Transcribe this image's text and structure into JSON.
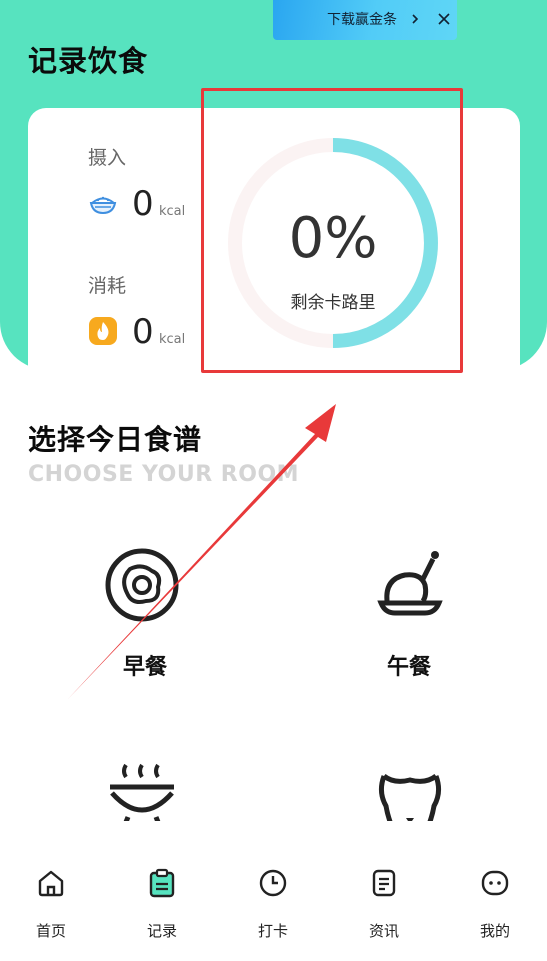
{
  "status_bar": {
    "left_fragment": "",
    "right_fragment": ""
  },
  "promo": {
    "text": "下载赢金条",
    "chevron_icon": "chevron-right-icon",
    "close_icon": "close-icon"
  },
  "header": {
    "title": "记录饮食"
  },
  "stats": {
    "intake": {
      "label": "摄入",
      "value": "0",
      "unit": "kcal",
      "icon": "rice-bowl-icon"
    },
    "burn": {
      "label": "消耗",
      "value": "0",
      "unit": "kcal",
      "icon": "flame-icon"
    },
    "ring": {
      "percent_text": "0%",
      "caption": "剩余卡路里",
      "progress": 0.5
    }
  },
  "recipe_section": {
    "title": "选择今日食谱",
    "subtitle": "CHOOSE YOUR ROOM",
    "meals": [
      {
        "label": "早餐",
        "icon": "fried-egg-plate-icon"
      },
      {
        "label": "午餐",
        "icon": "roast-chicken-icon"
      },
      {
        "label": "",
        "icon": "grill-icon"
      },
      {
        "label": "",
        "icon": "snack-icon"
      }
    ]
  },
  "tabbar": {
    "tabs": [
      {
        "label": "首页",
        "icon": "home-icon"
      },
      {
        "label": "记录",
        "icon": "clipboard-icon",
        "active": true
      },
      {
        "label": "打卡",
        "icon": "clock-icon"
      },
      {
        "label": "资讯",
        "icon": "document-icon"
      },
      {
        "label": "我的",
        "icon": "profile-face-icon"
      }
    ]
  },
  "colors": {
    "accent": "#57e3bf",
    "ring": "#7fe0e6",
    "annotation": "#e8393a",
    "banner": "#52ccf7"
  }
}
